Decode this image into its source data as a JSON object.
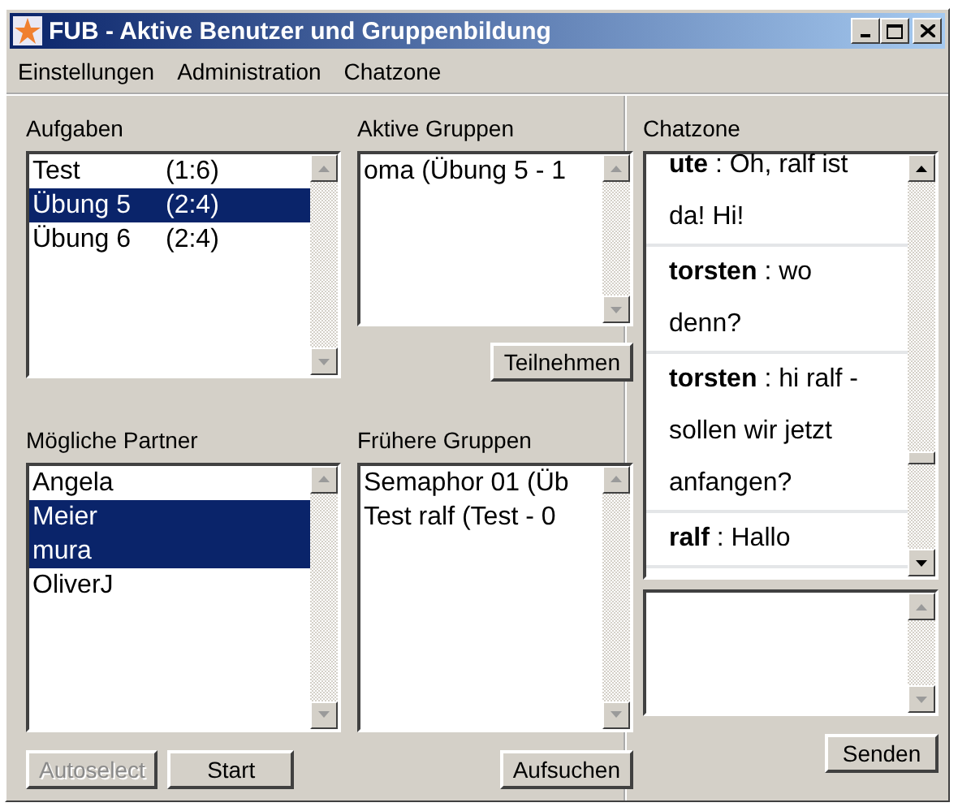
{
  "window": {
    "title": "FUB - Aktive Benutzer und Gruppenbildung"
  },
  "menu": [
    "Einstellungen",
    "Administration",
    "Chatzone"
  ],
  "tasks": {
    "label": "Aufgaben",
    "items": [
      {
        "name": "Test",
        "count": "(1:6)",
        "selected": false
      },
      {
        "name": "Übung 5",
        "count": "(2:4)",
        "selected": true
      },
      {
        "name": "Übung 6",
        "count": "(2:4)",
        "selected": false
      }
    ]
  },
  "active_groups": {
    "label": "Aktive Gruppen",
    "items": [
      {
        "name": "oma (Übung 5 - 1",
        "selected": false
      }
    ],
    "button": "Teilnehmen"
  },
  "partners": {
    "label": "Mögliche Partner",
    "items": [
      {
        "name": "Angela",
        "selected": false
      },
      {
        "name": "Meier",
        "selected": true
      },
      {
        "name": "mura",
        "selected": true
      },
      {
        "name": "OliverJ",
        "selected": false
      }
    ],
    "buttons": [
      {
        "label": "Autoselect",
        "disabled": true
      },
      {
        "label": "Start",
        "disabled": false
      }
    ]
  },
  "past_groups": {
    "label": "Frühere Gruppen",
    "items": [
      {
        "name": "Semaphor 01 (Üb",
        "selected": false
      },
      {
        "name": "Test ralf (Test - 0",
        "selected": false
      }
    ],
    "button": "Aufsuchen"
  },
  "chat": {
    "label": "Chatzone",
    "messages": [
      {
        "author": "ute",
        "text": ": Oh, ralf ist da! Hi!"
      },
      {
        "author": "torsten",
        "text": ": wo denn?"
      },
      {
        "author": "torsten",
        "text": ": hi ralf - sollen wir jetzt anfangen?"
      },
      {
        "author": "ralf",
        "text": ": Hallo"
      }
    ],
    "button": "Senden"
  }
}
